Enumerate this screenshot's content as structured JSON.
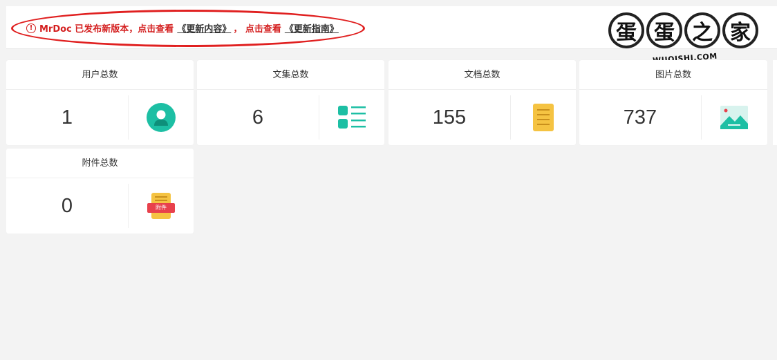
{
  "notice": {
    "icon": "!",
    "prefix": "MrDoc 已发布新版本，点击查看",
    "link1": "《更新内容》",
    "sep": "，  点击查看",
    "link2": "《更新指南》",
    "color": "#d42020"
  },
  "watermark": {
    "chars": [
      "蛋",
      "蛋",
      "之",
      "家"
    ],
    "sub": "WUQISHI.COM"
  },
  "stats": [
    {
      "label": "用户总数",
      "value": "1",
      "icon": "user-icon"
    },
    {
      "label": "文集总数",
      "value": "6",
      "icon": "list-icon"
    },
    {
      "label": "文档总数",
      "value": "155",
      "icon": "document-icon"
    },
    {
      "label": "图片总数",
      "value": "737",
      "icon": "image-icon"
    },
    {
      "label": "附件总数",
      "value": "0",
      "icon": "attachment-icon",
      "icon_text": "附件"
    }
  ],
  "colors": {
    "teal": "#1dbfa4",
    "yellow": "#f5c342",
    "red": "#e8414c"
  }
}
